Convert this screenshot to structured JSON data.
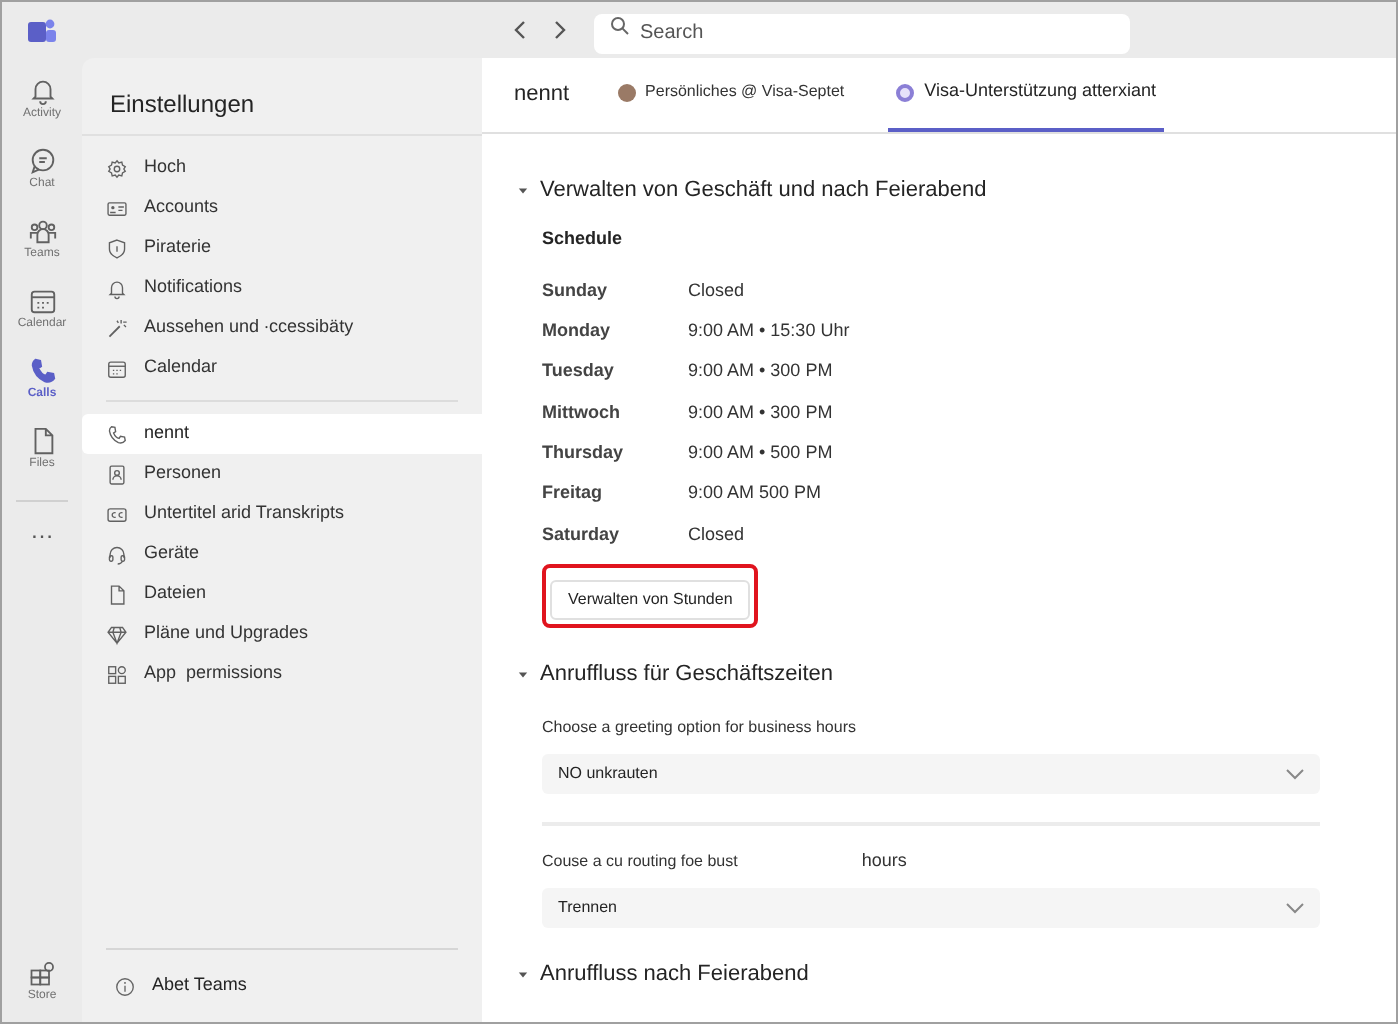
{
  "search": {
    "placeholder": "Search"
  },
  "rail": [
    {
      "label": "Activity",
      "selected": false
    },
    {
      "label": "Chat",
      "selected": false
    },
    {
      "label": "Teams",
      "selected": false
    },
    {
      "label": "Calendar",
      "selected": false
    },
    {
      "label": "Calls",
      "selected": true
    },
    {
      "label": "Files",
      "selected": false
    }
  ],
  "rail_more": {
    "label": "…"
  },
  "rail_bottom": {
    "label": "Store"
  },
  "settings": {
    "title": "Einstellungen",
    "groups": [
      [
        {
          "label": "Hoch",
          "selected": false
        },
        {
          "label": "Accounts",
          "selected": false
        },
        {
          "label": "Piraterie",
          "selected": false
        },
        {
          "label": "Notifications",
          "selected": false
        },
        {
          "label": "Aussehen und ∙ccessibäty",
          "selected": false
        },
        {
          "label": "Calendar",
          "selected": false
        }
      ],
      [
        {
          "label": "nennt",
          "selected": true
        },
        {
          "label": "Personen",
          "selected": false
        },
        {
          "label": "Untertitel arid Transkripts",
          "selected": false
        },
        {
          "label": "Geräte",
          "selected": false
        },
        {
          "label": "Dateien",
          "selected": false
        },
        {
          "label": "Pläne und Upgrades",
          "selected": false
        },
        {
          "label": "App  permissions",
          "selected": false
        }
      ]
    ],
    "footer": {
      "label": "Abet Teams"
    }
  },
  "header": {
    "title": "nennt",
    "tabs": [
      {
        "label": "Persönliches @ Visa-Septet",
        "selected": false
      },
      {
        "label": "Visa-Unterstützung atterxiant",
        "selected": true
      }
    ]
  },
  "sections": [
    {
      "title": "Verwalten von Geschäft und nach Feierabend",
      "expanded": true,
      "schedule": {
        "title": "Schedule",
        "rows": [
          {
            "day": "Sunday",
            "hours": "Closed"
          },
          {
            "day": "Monday",
            "hours": "9:00 AM • 15:30 Uhr"
          },
          {
            "day": "Tuesday",
            "hours": "9:00 AM • 300 PM"
          },
          {
            "day": "Mittwoch",
            "hours": "9:00 AM • 300 PM"
          },
          {
            "day": "Thursday",
            "hours": "9:00 AM • 500 PM"
          },
          {
            "day": "Freitag",
            "hours": "9:00 AM 500 PM"
          },
          {
            "day": "Saturday",
            "hours": "Closed"
          }
        ]
      },
      "button": {
        "label": "Verwalten von Stunden",
        "highlighted": true
      }
    },
    {
      "title": "Anruffluss für Geschäftszeiten",
      "expanded": true,
      "fields": [
        {
          "label": "Choose a greeting option for business hours",
          "value": "NO unkrauten"
        },
        {
          "label": "Couse a cu routing foe bust",
          "label_end": "hours",
          "value": "Trennen"
        }
      ]
    },
    {
      "title": "Anruffluss nach Feierabend",
      "expanded": true
    }
  ]
}
